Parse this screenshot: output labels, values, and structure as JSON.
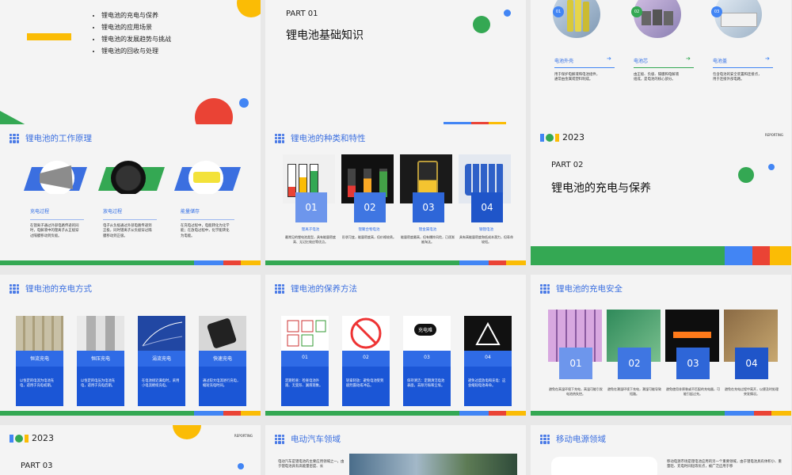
{
  "slides": {
    "s1": {
      "bullets": [
        "锂电池的充电与保养",
        "锂电池的应用场景",
        "锂电池的发展趋势与挑战",
        "锂电池的回收与处理"
      ]
    },
    "s2": {
      "part": "PART 01",
      "title": "锂电池基础知识"
    },
    "s3": {
      "items": [
        {
          "num": "01",
          "title": "电池外壳",
          "text": "用于保护电解液和电池组件，通常由金属或塑料制成。"
        },
        {
          "num": "02",
          "title": "电池芯",
          "text": "由正极、负极、隔膜和电解液组成，是电池的核心部分。"
        },
        {
          "num": "03",
          "title": "电池盖",
          "text": "包含电池的安全装置和连接点，用于连接外部电路。"
        }
      ]
    },
    "s4": {
      "header": "锂电池的工作原理",
      "items": [
        {
          "title": "充电过程",
          "text": "在锂离子通过外部电路传递的同时，电解液中的锂离子从正极穿过隔膜移动到负极。"
        },
        {
          "title": "放电过程",
          "text": "电子从负极通过外部电路传递到正极，同时锂离子从负极穿过隔膜移动到正极。"
        },
        {
          "title": "能量储存",
          "text": "在充电过程中，电能转化为化学能；在放电过程中，化学能转化为电能。"
        }
      ]
    },
    "s5": {
      "header": "锂电池的种类和特性",
      "items": [
        {
          "num": "01",
          "title": "锂离子电池",
          "text": "最常见的锂电池类型，具有能量密度高、无记忆效应等优点。"
        },
        {
          "num": "02",
          "title": "锂聚合物电池",
          "text": "形状可变，能量密度高，但价格较贵。"
        },
        {
          "num": "03",
          "title": "锂金属电池",
          "text": "能量密度最高，但有爆炸风险，已逐渐被淘汰。"
        },
        {
          "num": "04",
          "title": "钢锂电池",
          "text": "具有高能量密度和低成本潜力，但寿命较短。"
        }
      ]
    },
    "s6": {
      "year": "2023",
      "reporting": "REPORTING",
      "part": "PART 02",
      "title": "锂电池的充电与保养"
    },
    "s7": {
      "header": "锂电池的充电方式",
      "items": [
        {
          "title": "恒流充电",
          "text": "以恒定的电流为电池充电，适用于充电初期。"
        },
        {
          "title": "恒压充电",
          "text": "以恒定的电压为电池充电，适用于充电后期。"
        },
        {
          "title": "涓流充电",
          "text": "在电池接近满电时，采用小电流继续充电。"
        },
        {
          "title": "快速充电",
          "text": "通过较大电流进行充电，缩短充电时间。"
        }
      ]
    },
    "s8": {
      "header": "锂电池的保养方法",
      "charge_sign": "充电难",
      "items": [
        {
          "num": "01",
          "text": "定期检查：检查电池外观、无变形、漏液现象。"
        },
        {
          "num": "02",
          "text": "轻拿轻放：避免电池受到剧烈震动或冲击。"
        },
        {
          "num": "03",
          "text": "保持清洁：定期清洁电池表面，去除污垢和尘埃。"
        },
        {
          "num": "04",
          "text": "避免过度放电和充电：这会缩短电池寿命。"
        }
      ]
    },
    "s9": {
      "header": "锂电池的充电安全",
      "items": [
        {
          "num": "01",
          "text": "避免在高温环境下充电，高温可能引发电池热失控。"
        },
        {
          "num": "02",
          "text": "避免在潮湿环境下充电，潮湿可能导致短路。"
        },
        {
          "num": "03",
          "text": "避免使用非原装或不匹配的充电器，可能引起过充。"
        },
        {
          "num": "04",
          "text": "避免在充电过程中离开，以便及时处理突发情况。"
        }
      ]
    },
    "s10": {
      "year": "2023",
      "reporting": "REPORTING",
      "part": "PART 03"
    },
    "s11": {
      "header": "电动汽车领域",
      "text": "电动汽车是锂电池的主要应用领域之一，由于锂电池具有高能量密度、长"
    },
    "s12": {
      "header": "移动电源领域",
      "text": "移动电源市场是锂电池应用的另一个重要领域，由于锂电池具有体积小、重量轻、充电时间短等优点，被广泛应用于移"
    }
  },
  "colors": {
    "blue": "#4285f4",
    "red": "#ea4335",
    "yellow": "#fbbc05",
    "green": "#34a853",
    "title_blue": "#3b6fe0",
    "card_dark": "#1b56d6"
  }
}
